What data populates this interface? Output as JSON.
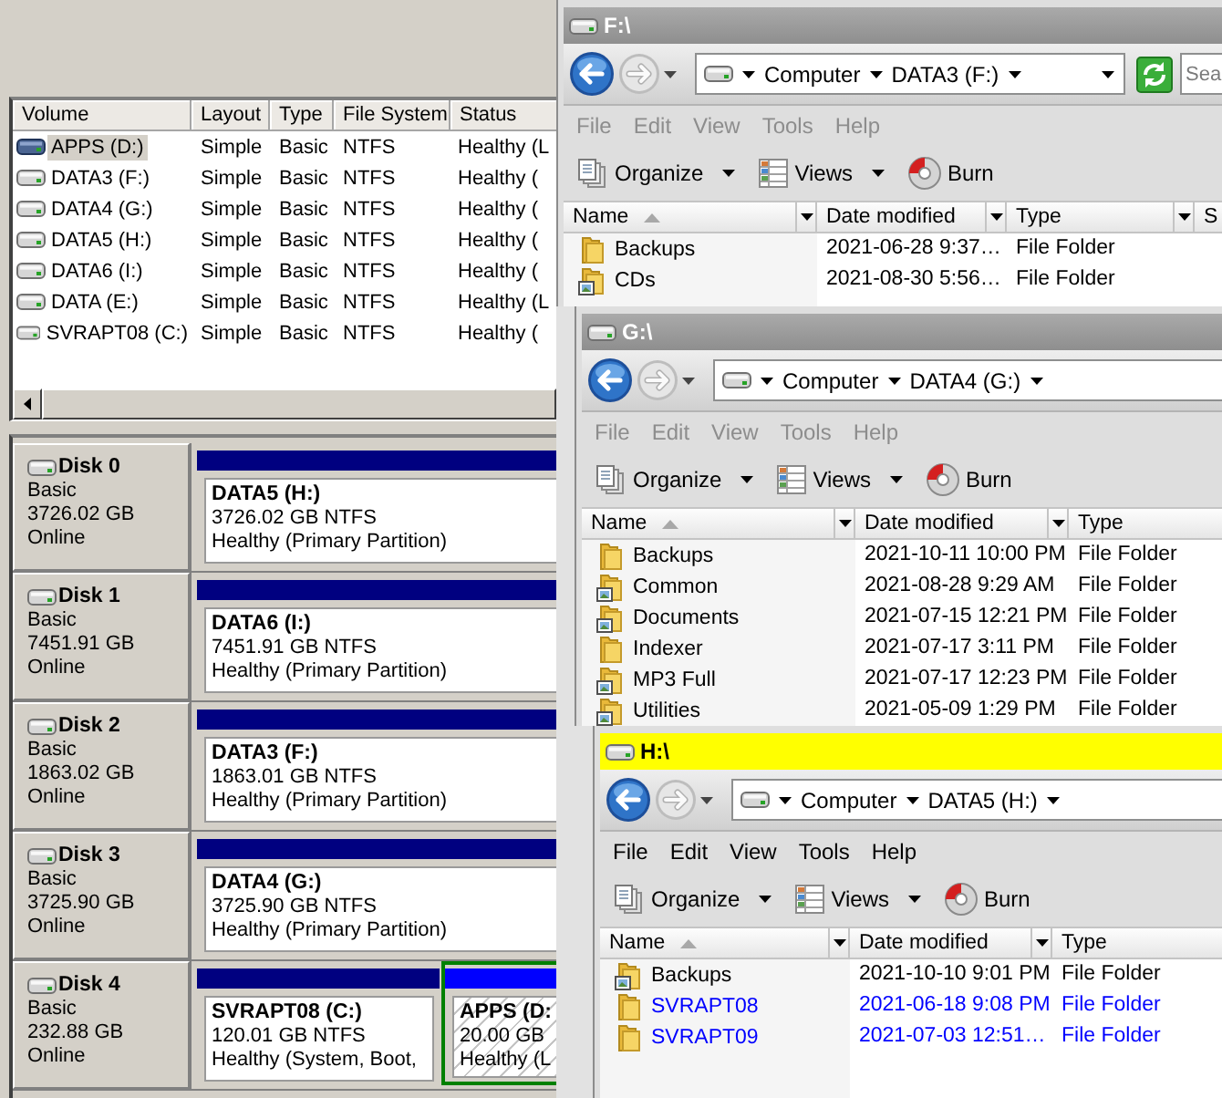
{
  "volume_list": {
    "columns": [
      "Volume",
      "Layout",
      "Type",
      "File System",
      "Status"
    ],
    "rows": [
      {
        "volume": "APPS (D:)",
        "layout": "Simple",
        "type": "Basic",
        "file_system": "NTFS",
        "status": "Healthy (L",
        "selected": true
      },
      {
        "volume": "DATA3 (F:)",
        "layout": "Simple",
        "type": "Basic",
        "file_system": "NTFS",
        "status": "Healthy (",
        "selected": false
      },
      {
        "volume": "DATA4 (G:)",
        "layout": "Simple",
        "type": "Basic",
        "file_system": "NTFS",
        "status": "Healthy (",
        "selected": false
      },
      {
        "volume": "DATA5 (H:)",
        "layout": "Simple",
        "type": "Basic",
        "file_system": "NTFS",
        "status": "Healthy (",
        "selected": false
      },
      {
        "volume": "DATA6 (I:)",
        "layout": "Simple",
        "type": "Basic",
        "file_system": "NTFS",
        "status": "Healthy (",
        "selected": false
      },
      {
        "volume": "DATA (E:)",
        "layout": "Simple",
        "type": "Basic",
        "file_system": "NTFS",
        "status": "Healthy (L",
        "selected": false
      },
      {
        "volume": "SVRAPT08 (C:)",
        "layout": "Simple",
        "type": "Basic",
        "file_system": "NTFS",
        "status": "Healthy (",
        "selected": false
      }
    ]
  },
  "disks": [
    {
      "name": "Disk 0",
      "type": "Basic",
      "size": "3726.02 GB",
      "status": "Online",
      "partitions": [
        {
          "name": "DATA5 (H:)",
          "size": "3726.02 GB NTFS",
          "status": "Healthy (Primary Partition)",
          "kind": "primary",
          "selected": false
        }
      ]
    },
    {
      "name": "Disk 1",
      "type": "Basic",
      "size": "7451.91 GB",
      "status": "Online",
      "partitions": [
        {
          "name": "DATA6 (I:)",
          "size": "7451.91 GB NTFS",
          "status": "Healthy (Primary Partition)",
          "kind": "primary",
          "selected": false
        }
      ]
    },
    {
      "name": "Disk 2",
      "type": "Basic",
      "size": "1863.02 GB",
      "status": "Online",
      "partitions": [
        {
          "name": "DATA3 (F:)",
          "size": "1863.01 GB NTFS",
          "status": "Healthy (Primary Partition)",
          "kind": "primary",
          "selected": false
        }
      ]
    },
    {
      "name": "Disk 3",
      "type": "Basic",
      "size": "3725.90 GB",
      "status": "Online",
      "partitions": [
        {
          "name": "DATA4 (G:)",
          "size": "3725.90 GB NTFS",
          "status": "Healthy (Primary Partition)",
          "kind": "primary",
          "selected": false
        }
      ]
    },
    {
      "name": "Disk 4",
      "type": "Basic",
      "size": "232.88 GB",
      "status": "Online",
      "partitions": [
        {
          "name": "SVRAPT08 (C:)",
          "size": "120.01 GB NTFS",
          "status": "Healthy (System, Boot,",
          "kind": "primary",
          "selected": false
        },
        {
          "name": "APPS (D:",
          "size": "20.00 GB",
          "status": "Healthy (L",
          "kind": "logical",
          "selected": true
        }
      ]
    }
  ],
  "windows": [
    {
      "title": "F:\\",
      "active": false,
      "breadcrumb": [
        "Computer",
        "DATA3 (F:)"
      ],
      "search": {
        "placeholder": "Sea"
      },
      "menu": [
        "File",
        "Edit",
        "View",
        "Tools",
        "Help"
      ],
      "toolbar": [
        {
          "label": "Organize",
          "kind": "menu"
        },
        {
          "label": "Views",
          "kind": "menu"
        },
        {
          "label": "Burn",
          "kind": "button"
        }
      ],
      "columns": [
        {
          "label": "Name",
          "sorted": true
        },
        {
          "label": "Date modified",
          "sorted": false
        },
        {
          "label": "Type",
          "sorted": false
        }
      ],
      "partial_column": "S",
      "rows": [
        {
          "name": "Backups",
          "kind": "folder",
          "date_modified": "2021-06-28 9:37…",
          "type": "File Folder",
          "compressed": false
        },
        {
          "name": "CDs",
          "kind": "picture-folder",
          "date_modified": "2021-08-30 5:56…",
          "type": "File Folder",
          "compressed": false
        }
      ]
    },
    {
      "title": "G:\\",
      "active": false,
      "breadcrumb": [
        "Computer",
        "DATA4 (G:)"
      ],
      "menu": [
        "File",
        "Edit",
        "View",
        "Tools",
        "Help"
      ],
      "toolbar": [
        {
          "label": "Organize",
          "kind": "menu"
        },
        {
          "label": "Views",
          "kind": "menu"
        },
        {
          "label": "Burn",
          "kind": "button"
        }
      ],
      "columns": [
        {
          "label": "Name",
          "sorted": true
        },
        {
          "label": "Date modified",
          "sorted": false
        },
        {
          "label": "Type",
          "sorted": false
        }
      ],
      "rows": [
        {
          "name": "Backups",
          "kind": "folder",
          "date_modified": "2021-10-11 10:00 PM",
          "type": "File Folder",
          "compressed": false
        },
        {
          "name": "Common",
          "kind": "picture-folder",
          "date_modified": "2021-08-28 9:29 AM",
          "type": "File Folder",
          "compressed": false
        },
        {
          "name": "Documents",
          "kind": "picture-folder",
          "date_modified": "2021-07-15 12:21 PM",
          "type": "File Folder",
          "compressed": false
        },
        {
          "name": "Indexer",
          "kind": "folder",
          "date_modified": "2021-07-17 3:11 PM",
          "type": "File Folder",
          "compressed": false
        },
        {
          "name": "MP3 Full",
          "kind": "picture-folder",
          "date_modified": "2021-07-17 12:23 PM",
          "type": "File Folder",
          "compressed": false
        },
        {
          "name": "Utilities",
          "kind": "picture-folder",
          "date_modified": "2021-05-09 1:29 PM",
          "type": "File Folder",
          "compressed": false
        }
      ]
    },
    {
      "title": "H:\\",
      "active": true,
      "breadcrumb": [
        "Computer",
        "DATA5 (H:)"
      ],
      "menu": [
        "File",
        "Edit",
        "View",
        "Tools",
        "Help"
      ],
      "toolbar": [
        {
          "label": "Organize",
          "kind": "menu"
        },
        {
          "label": "Views",
          "kind": "menu"
        },
        {
          "label": "Burn",
          "kind": "button"
        }
      ],
      "columns": [
        {
          "label": "Name",
          "sorted": true
        },
        {
          "label": "Date modified",
          "sorted": false
        },
        {
          "label": "Type",
          "sorted": false
        }
      ],
      "rows": [
        {
          "name": "Backups",
          "kind": "picture-folder",
          "date_modified": "2021-10-10 9:01 PM",
          "type": "File Folder",
          "compressed": false
        },
        {
          "name": "SVRAPT08",
          "kind": "folder",
          "date_modified": "2021-06-18 9:08 PM",
          "type": "File Folder",
          "compressed": true
        },
        {
          "name": "SVRAPT09",
          "kind": "folder",
          "date_modified": "2021-07-03 12:51…",
          "type": "File Folder",
          "compressed": true
        }
      ]
    }
  ]
}
